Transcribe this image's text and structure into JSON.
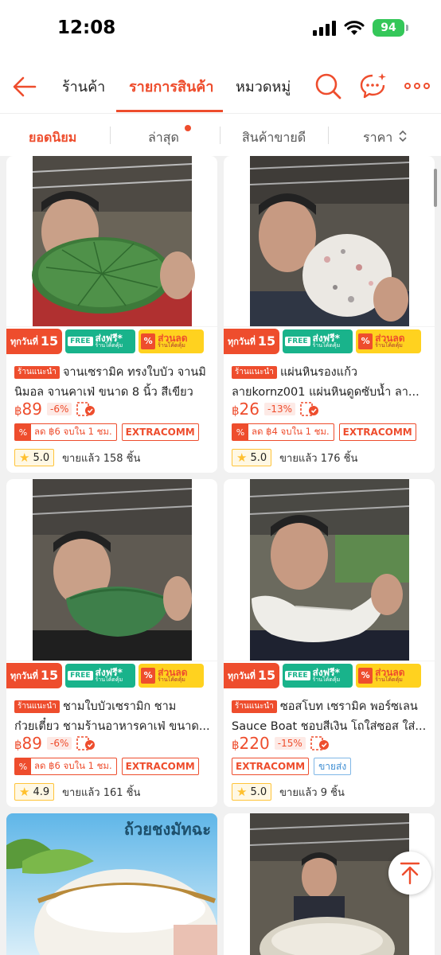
{
  "status": {
    "time": "12:08",
    "battery": "94"
  },
  "nav": {
    "tabs": [
      {
        "label": "ร้านค้า"
      },
      {
        "label": "รายการสินค้า"
      },
      {
        "label": "หมวดหมู่"
      }
    ],
    "active_tab": "รายการสินค้า"
  },
  "sort": {
    "items": [
      {
        "label": "ยอดนิยม"
      },
      {
        "label": "ล่าสุด"
      },
      {
        "label": "สินค้าขายดี"
      },
      {
        "label": "ราคา"
      }
    ],
    "active": "ยอดนิยม"
  },
  "promo": {
    "day_prefix": "ทุกวันที่",
    "day_number": "15",
    "free_box": "FREE",
    "free_label": "ส่งฟรี*",
    "free_sub": "ร้านโค้ดคุ้ม",
    "disc_label": "ส่วนลด",
    "disc_sub": "ร้านโค้ดคุ้ม",
    "pct": "%"
  },
  "tags": {
    "recommended": "ร้านแนะนำ",
    "extra": "EXTRACOMM",
    "wholesale": "ขายส่ง"
  },
  "products": [
    {
      "title": "จานเซรามิค ทรงใบบัว จานมินิมอล จานคาเฟ่ ขนาด 8 นิ้ว สีเขียว เ...",
      "currency": "฿",
      "price": "89",
      "discount": "-6%",
      "voucher": "ลด ฿6 จบใน 1 ชม.",
      "rating": "5.0",
      "sold": "ขายแล้ว 158 ชิ้น"
    },
    {
      "title": "แผ่นหินรองแก้ว ลายkornz001 แผ่นหินดูดซับน้ำ ลา...",
      "currency": "฿",
      "price": "26",
      "discount": "-13%",
      "voucher": "ลด ฿4 จบใน 1 ชม.",
      "rating": "5.0",
      "sold": "ขายแล้ว 176 ชิ้น"
    },
    {
      "title": "ชามใบบัวเซรามิก ชามก๋วยเตี๋ยว ชามร้านอาหารคาเฟ่ ขนาด...",
      "currency": "฿",
      "price": "89",
      "discount": "-6%",
      "voucher": "ลด ฿6 จบใน 1 ชม.",
      "rating": "4.9",
      "sold": "ขายแล้ว 161 ชิ้น"
    },
    {
      "title": "ซอสโบท เซรามิค พอร์ซเลน Sauce Boat ชอบสีเงิน โถใส่ซอส ใส่...",
      "currency": "฿",
      "price": "220",
      "discount": "-15%",
      "rating": "5.0",
      "sold": "ขายแล้ว 9 ชิ้น"
    }
  ],
  "banner": {
    "text": "ถ้วยชงมัทฉะ"
  },
  "colors": {
    "accent": "#ee4d2d",
    "battery": "#34c759",
    "free": "#19b38b",
    "disc": "#ffd21f"
  }
}
